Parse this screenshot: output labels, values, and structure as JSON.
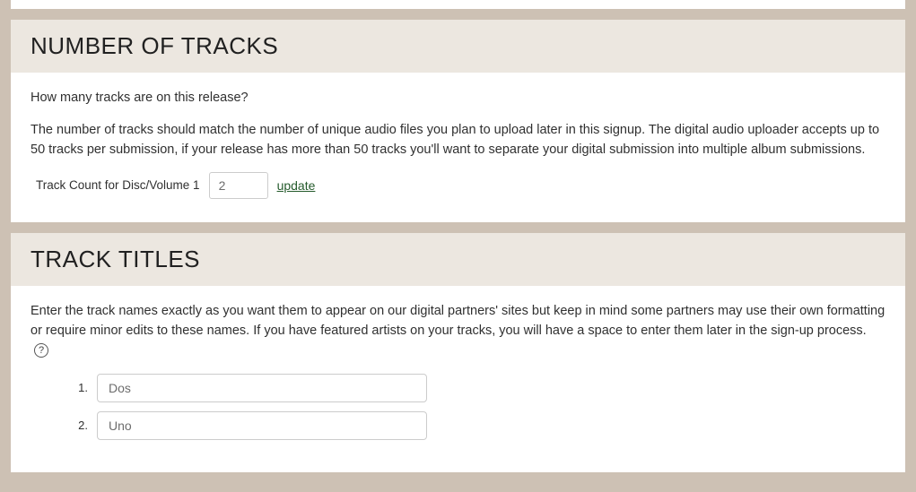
{
  "sections": {
    "numTracks": {
      "title": "Number of Tracks",
      "q": "How many tracks are on this release?",
      "desc": "The number of tracks should match the number of unique audio files you plan to upload later in this signup. The digital audio uploader accepts up to 50 tracks per submission, if your release has more than 50 tracks you'll want to separate your digital submission into multiple album submissions.",
      "fieldLabel": "Track Count for Disc/Volume 1",
      "countValue": "2",
      "updateLabel": "update"
    },
    "trackTitles": {
      "title": "Track Titles",
      "desc": "Enter the track names exactly as you want them to appear on our digital partners' sites but keep in mind some partners may use their own formatting or require minor edits to these names. If you have featured artists on your tracks, you will have a space to enter them later in the sign-up process.",
      "tracks": [
        {
          "n": "1.",
          "title": "Dos"
        },
        {
          "n": "2.",
          "title": "Uno"
        }
      ]
    }
  }
}
